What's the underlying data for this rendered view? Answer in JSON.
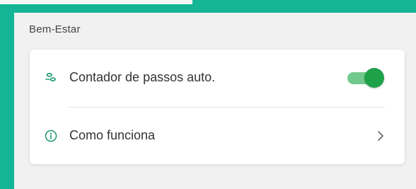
{
  "section": {
    "title": "Bem-Estar"
  },
  "rows": [
    {
      "icon": "footprints-icon",
      "label": "Contador de passos auto.",
      "control": "toggle",
      "toggle_on": true
    },
    {
      "icon": "info-icon",
      "label": "Como funciona",
      "control": "chevron"
    }
  ],
  "colors": {
    "frame": "#14b596",
    "panel": "#f1f1f1",
    "icon": "#1a9a6a",
    "toggle_track": "#72c98d",
    "toggle_knob": "#1fa14a"
  }
}
